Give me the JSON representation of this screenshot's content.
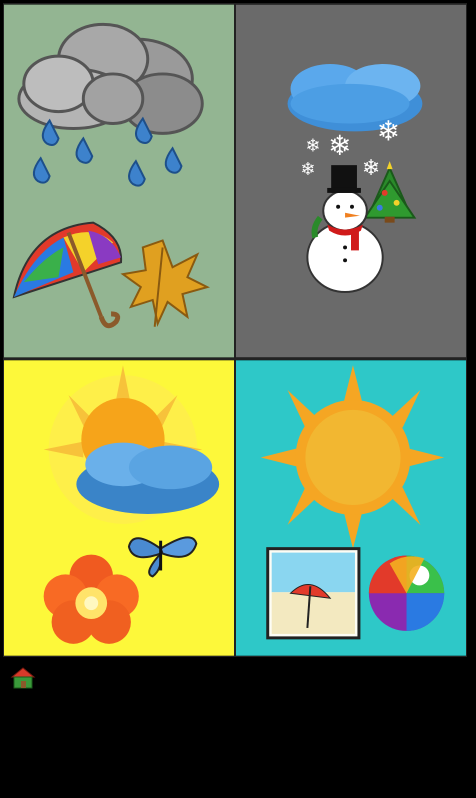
{
  "tiles": [
    {
      "id": "autumn",
      "season": "autumn",
      "bg": "#93b592"
    },
    {
      "id": "winter",
      "season": "winter",
      "bg": "#6a6a6a"
    },
    {
      "id": "spring",
      "season": "spring",
      "bg": "#fdf83a"
    },
    {
      "id": "summer",
      "season": "summer",
      "bg": "#2ec8c8"
    }
  ],
  "footer": {
    "home_icon": "home-icon"
  },
  "colors": {
    "background": "#000000",
    "border": "#222222"
  }
}
